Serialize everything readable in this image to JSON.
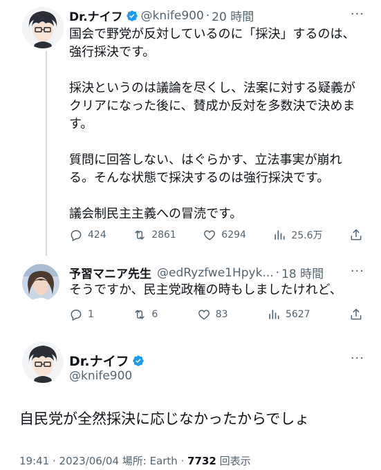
{
  "tweet1": {
    "name": "Dr.ナイフ",
    "handle": "@knife900",
    "dot": "·",
    "time": "20 時間",
    "more": "···",
    "paragraphs": [
      "国会で野党が反対しているのに「採決」するのは、強行採決です。",
      "採決というのは議論を尽くし、法案に対する疑義がクリアになった後に、賛成か反対を多数決で決めます。",
      "質問に回答しない、はぐらかす、立法事実が崩れる。そんな状態で採決するのは強行採決です。",
      "議会制民主主義への冒涜です。"
    ],
    "replies": "424",
    "retweets": "2861",
    "likes": "6294",
    "views": "25.6万"
  },
  "tweet2": {
    "name": "予習マニア先生",
    "handle": "@edRyzfwe1Hpyk...",
    "dot": "·",
    "time": "18 時間",
    "more": "···",
    "text": "そうですか、民主党政権の時もしましたけれど、",
    "replies": "1",
    "retweets": "6",
    "likes": "83",
    "views": "5627"
  },
  "tweet3": {
    "name": "Dr.ナイフ",
    "handle": "@knife900",
    "more": "···",
    "text": "自民党が全然採決に応じなかったからでしょ",
    "meta_prefix": "19:41 · 2023/06/04 場所: Earth · ",
    "view_count": "7732",
    "meta_suffix": " 回表示"
  },
  "colors": {
    "verified": "#1d9bf0",
    "secondary_text": "#536471",
    "primary_text": "#0f1419"
  }
}
